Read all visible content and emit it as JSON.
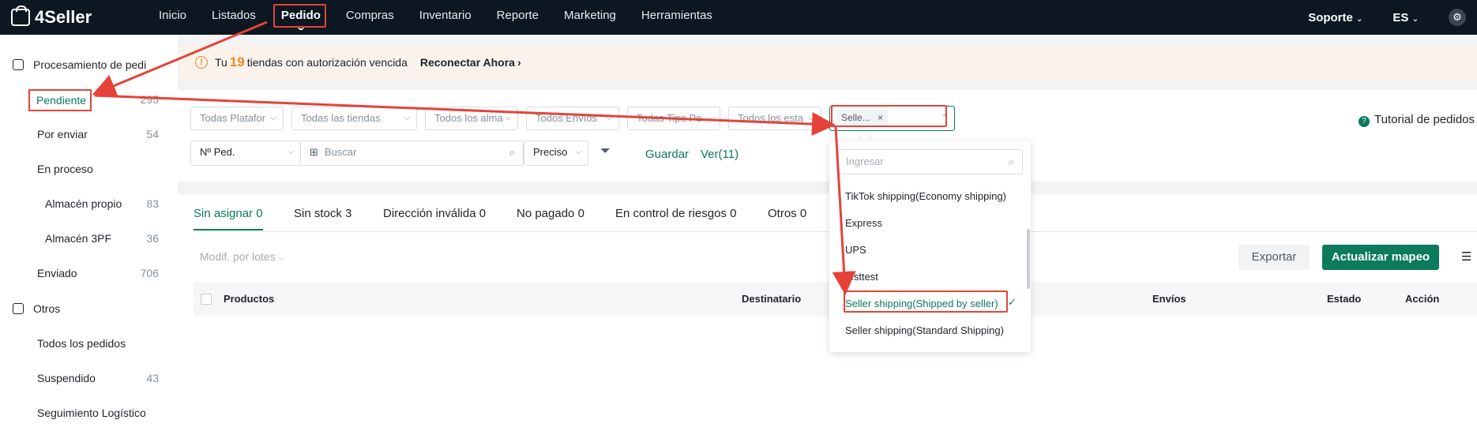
{
  "topbar": {
    "logo": "4Seller",
    "nav": [
      "Inicio",
      "Listados",
      "Pedido",
      "Compras",
      "Inventario",
      "Reporte",
      "Marketing",
      "Herramientas"
    ],
    "active_nav": "Pedido",
    "soporte": "Soporte",
    "lang": "ES"
  },
  "sidebar": {
    "group1": "Procesamiento de pedi",
    "items": [
      {
        "label": "Pendiente",
        "count": "295"
      },
      {
        "label": "Por enviar",
        "count": "54"
      },
      {
        "label": "En proceso",
        "count": ""
      },
      {
        "label": "Almacén propio",
        "count": "83"
      },
      {
        "label": "Almacén 3PF",
        "count": "36"
      },
      {
        "label": "Enviado",
        "count": "706"
      }
    ],
    "group2": "Otros",
    "others": [
      {
        "label": "Todos los pedidos",
        "count": ""
      },
      {
        "label": "Suspendido",
        "count": "43"
      },
      {
        "label": "Seguimiento Logístico",
        "count": ""
      }
    ]
  },
  "banner": {
    "pre": "Tu",
    "count": "19",
    "post": "tiendas con autorización vencida",
    "action": "Reconectar Ahora"
  },
  "filters": {
    "f1": "Todas Platafor",
    "f2": "Todas las tiendas",
    "f3": "Todos los alma",
    "f4": "Todos Envíos",
    "f5": "Todas Tipo Pe",
    "f6": "Todos los esta",
    "f7_tag": "Selle...",
    "order_field": "Nº Ped.",
    "search_placeholder": "Buscar",
    "match": "Preciso",
    "save": "Guardar",
    "view": "Ver(11)",
    "tutorial": "Tutorial de pedidos"
  },
  "tabs": [
    "Sin asignar 0",
    "Sin stock 3",
    "Dirección inválida 0",
    "No pagado 0",
    "En control de riesgos 0",
    "Otros 0"
  ],
  "toolbar": {
    "batch": "Modif. por lotes",
    "export": "Exportar",
    "update": "Actualizar mapeo"
  },
  "table_headers": [
    "Productos",
    "Destinatario",
    "Envíos",
    "Estado",
    "Acción"
  ],
  "dropdown": {
    "placeholder": "Ingresar",
    "options": [
      "TikTok shipping(Economy shipping)",
      "Express",
      "UPS",
      "testtest",
      "Seller shipping(Shipped by seller)",
      "Seller shipping(Standard Shipping)"
    ],
    "selected_index": 4
  },
  "colors": {
    "accent": "#0b7a5d",
    "annotation": "#e5433a",
    "warning": "#f08a24",
    "topbar": "#0c1722"
  }
}
